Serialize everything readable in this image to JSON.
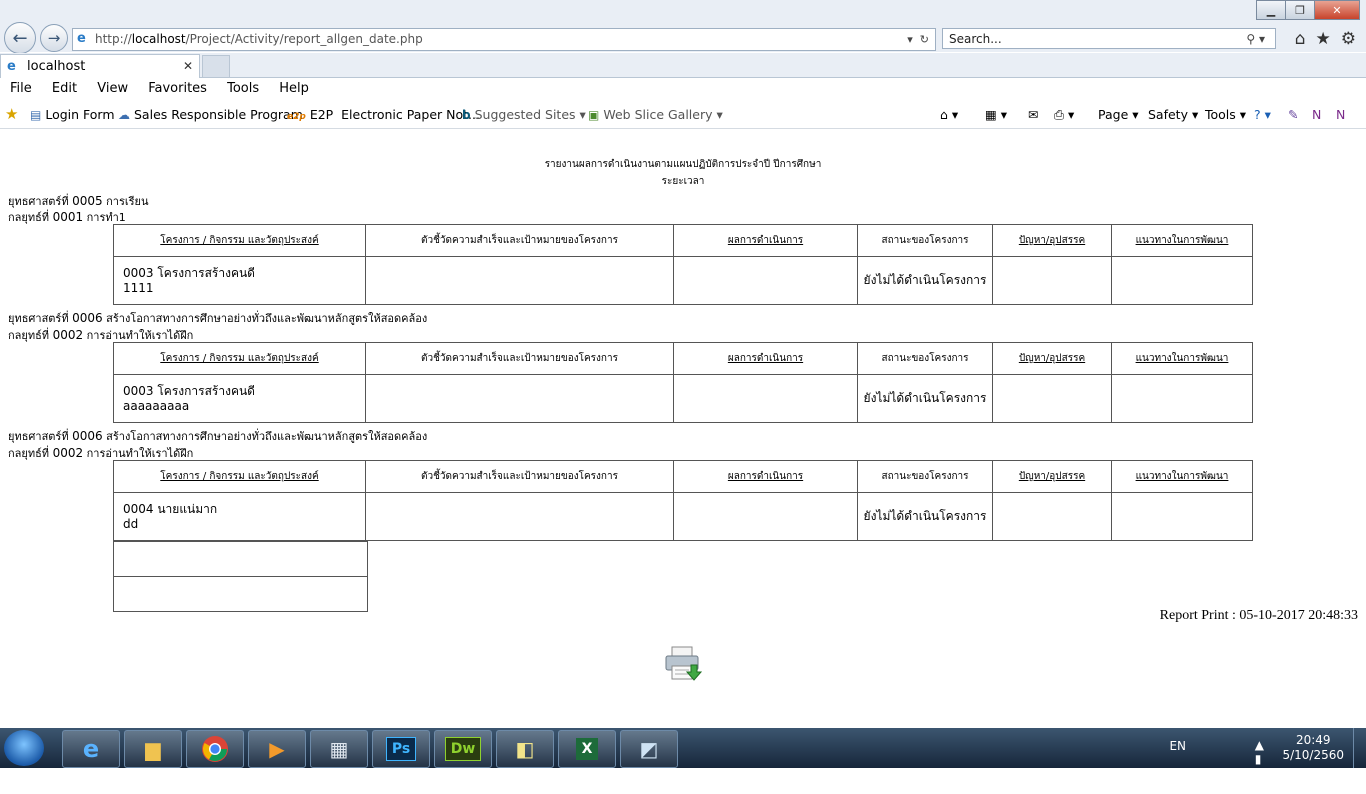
{
  "browser": {
    "address_prefix": "http://",
    "address_host": "localhost",
    "address_path": "/Project/Activity/report_allgen_date.php",
    "search_placeholder": "Search...",
    "tab_title": "localhost",
    "menu": [
      "File",
      "Edit",
      "View",
      "Favorites",
      "Tools",
      "Help"
    ],
    "favorites": [
      "Login Form",
      "Sales Responsible Program",
      "E2P",
      "Electronic Paper Not...",
      "Suggested Sites",
      "Web Slice Gallery"
    ],
    "commands": [
      "Page",
      "Safety",
      "Tools"
    ]
  },
  "report": {
    "title": "รายงานผลการดำเนินงานตามแผนปฏิบัติการประจำปี ปีการศึกษา",
    "subtitle": "ระยะเวลา",
    "headers": [
      "โครงการ / กิจกรรม และวัตถุประสงค์",
      "ตัวชี้วัดความสำเร็จและเป้าหมายของโครงการ",
      "ผลการดำเนินการ",
      "สถานะของโครงการ",
      "ปัญหา/อุปสรรค",
      "แนวทางในการพัฒนา"
    ],
    "sections": [
      {
        "strategy_prefix": "ยุทธศาสตร์ที่",
        "strategy_code": "0005",
        "strategy_name": "การเรียน",
        "group_prefix": "กลยุทธ์ที่",
        "group_code": "0001",
        "group_name": "การทำ1",
        "project_code_name": "0003 โครงการสร้างคนดี",
        "project_detail": "1111",
        "status": "ยังไม่ได้ดำเนินโครงการ"
      },
      {
        "strategy_prefix": "ยุทธศาสตร์ที่",
        "strategy_code": "0006",
        "strategy_name": "สร้างโอกาสทางการศึกษาอย่างทั่วถึงและพัฒนาหลักสูตรให้สอดคล้อง",
        "group_prefix": "กลยุทธ์ที่",
        "group_code": "0002",
        "group_name": "การอ่านทำให้เราได้ฝึก",
        "project_code_name": "0003 โครงการสร้างคนดี",
        "project_detail": "aaaaaaaaa",
        "status": "ยังไม่ได้ดำเนินโครงการ"
      },
      {
        "strategy_prefix": "ยุทธศาสตร์ที่",
        "strategy_code": "0006",
        "strategy_name": "สร้างโอกาสทางการศึกษาอย่างทั่วถึงและพัฒนาหลักสูตรให้สอดคล้อง",
        "group_prefix": "กลยุทธ์ที่",
        "group_code": "0002",
        "group_name": "การอ่านทำให้เราได้ฝึก",
        "project_code_name": "0004 นายแน่มาก",
        "project_detail": "dd",
        "status": "ยังไม่ได้ดำเนินโครงการ"
      }
    ],
    "report_print": "Report Print : 05-10-2017 20:48:33"
  },
  "taskbar": {
    "apps": [
      "ie",
      "explorer",
      "chrome",
      "media",
      "calculator",
      "Ps",
      "Dw",
      "notes",
      "excel",
      "paper"
    ],
    "ps_label": "Ps",
    "dw_label": "Dw",
    "language": "EN",
    "time": "20:49",
    "date": "5/10/2560"
  },
  "colors": {
    "taskbar": "#1f3550",
    "ps": "#0a2a4a",
    "dw": "#2a3d10",
    "excel": "#1d6b3a"
  }
}
